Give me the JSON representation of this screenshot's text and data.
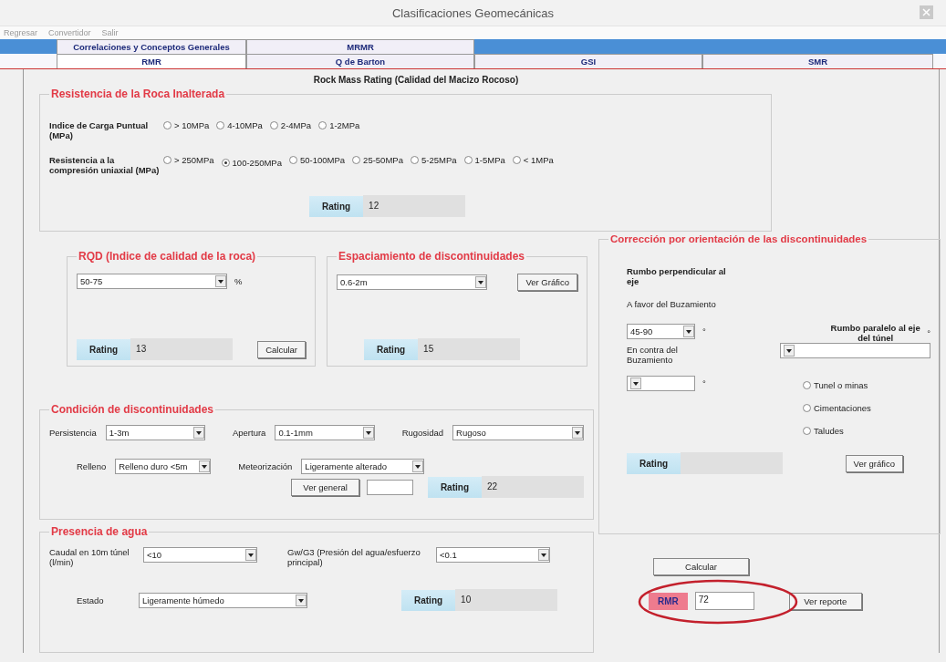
{
  "window": {
    "title": "Clasificaciones Geomecánicas"
  },
  "menu": [
    {
      "label": "Regresar"
    },
    {
      "label": "Convertidor"
    },
    {
      "label": "Salir"
    }
  ],
  "tabs_row_1": [
    {
      "label": "Correlaciones y Conceptos Generales",
      "selected": false
    },
    {
      "label": "MRMR",
      "selected": false
    }
  ],
  "tabs_row_2": [
    {
      "label": "RMR",
      "selected": true
    },
    {
      "label": "Q de Barton",
      "selected": false
    },
    {
      "label": "GSI",
      "selected": false
    },
    {
      "label": "SMR",
      "selected": false
    }
  ],
  "heading": "Rock Mass Rating (Calidad del Macizo Rocoso)",
  "intact_rock": {
    "title": "Resistencia de la Roca Inalterada",
    "groups": [
      {
        "label": "Indice de Carga Puntual (MPa)",
        "options": [
          {
            "label": "> 10MPa",
            "selected": false
          },
          {
            "label": "4-10MPa",
            "selected": false
          },
          {
            "label": "2-4MPa",
            "selected": false
          },
          {
            "label": "1-2MPa",
            "selected": false
          }
        ]
      },
      {
        "label": "Resistencia a la compresión uniaxial (MPa)",
        "options": [
          {
            "label": "> 250MPa",
            "selected": false
          },
          {
            "label": "100-250MPa",
            "selected": true
          },
          {
            "label": "50-100MPa",
            "selected": false
          },
          {
            "label": "25-50MPa",
            "selected": false
          },
          {
            "label": "5-25MPa",
            "selected": false
          },
          {
            "label": "1-5MPa",
            "selected": false
          },
          {
            "label": "< 1MPa",
            "selected": false
          }
        ]
      }
    ],
    "rating_label": "Rating",
    "rating": "12"
  },
  "rqd": {
    "title": "RQD (Indice de calidad de la roca)",
    "value": "50-75",
    "unit": "%",
    "rating_label": "Rating",
    "rating": "13",
    "button": "Calcular"
  },
  "spacing": {
    "title": "Espaciamiento de discontinuidades",
    "value": "0.6-2m",
    "button": "Ver Gráfico",
    "rating_label": "Rating",
    "rating": "15"
  },
  "condition": {
    "title": "Condición de discontinuidades",
    "rows": [
      [
        {
          "label": "Persistencia",
          "value": "1-3m"
        },
        {
          "label": "Apertura",
          "value": "0.1-1mm"
        },
        {
          "label": "Rugosidad",
          "value": "Rugoso"
        }
      ],
      [
        {
          "label": "Relleno",
          "value": "Relleno duro <5m"
        },
        {
          "label": "Meteorización",
          "value": "Ligeramente alterado"
        }
      ]
    ],
    "button": "Ver general",
    "rating_label": "Rating",
    "rating": "22"
  },
  "water": {
    "title": "Presencia de agua",
    "fields": [
      {
        "label": "Caudal en 10m túnel (l/min)",
        "value": "<10"
      },
      {
        "label": "Gw/G3 (Presión del agua/esfuerzo principal)",
        "value": "<0.1"
      },
      {
        "label": "Estado",
        "value": "Ligeramente húmedo"
      }
    ],
    "rating_label": "Rating",
    "rating": "10"
  },
  "orientation": {
    "title": "Corrección por orientación de las discontinuidades",
    "perpendicular_label": "Rumbo perpendicular al eje",
    "favor_label": "A favor del Buzamiento",
    "favor_value": "45-90",
    "favor_unit": "°",
    "contra_label": "En contra del Buzamiento",
    "contra_unit": "°",
    "parallel_label": "Rumbo paralelo al eje del túnel",
    "parallel_unit": "°",
    "options": [
      {
        "label": "Tunel o minas",
        "selected": false
      },
      {
        "label": "Cimentaciones",
        "selected": false
      },
      {
        "label": "Taludes",
        "selected": false
      }
    ],
    "rating_label": "Rating",
    "button": "Ver gráfico"
  },
  "result": {
    "calc_button": "Calcular",
    "label": "RMR",
    "value": "72",
    "report_button": "Ver reporte"
  }
}
